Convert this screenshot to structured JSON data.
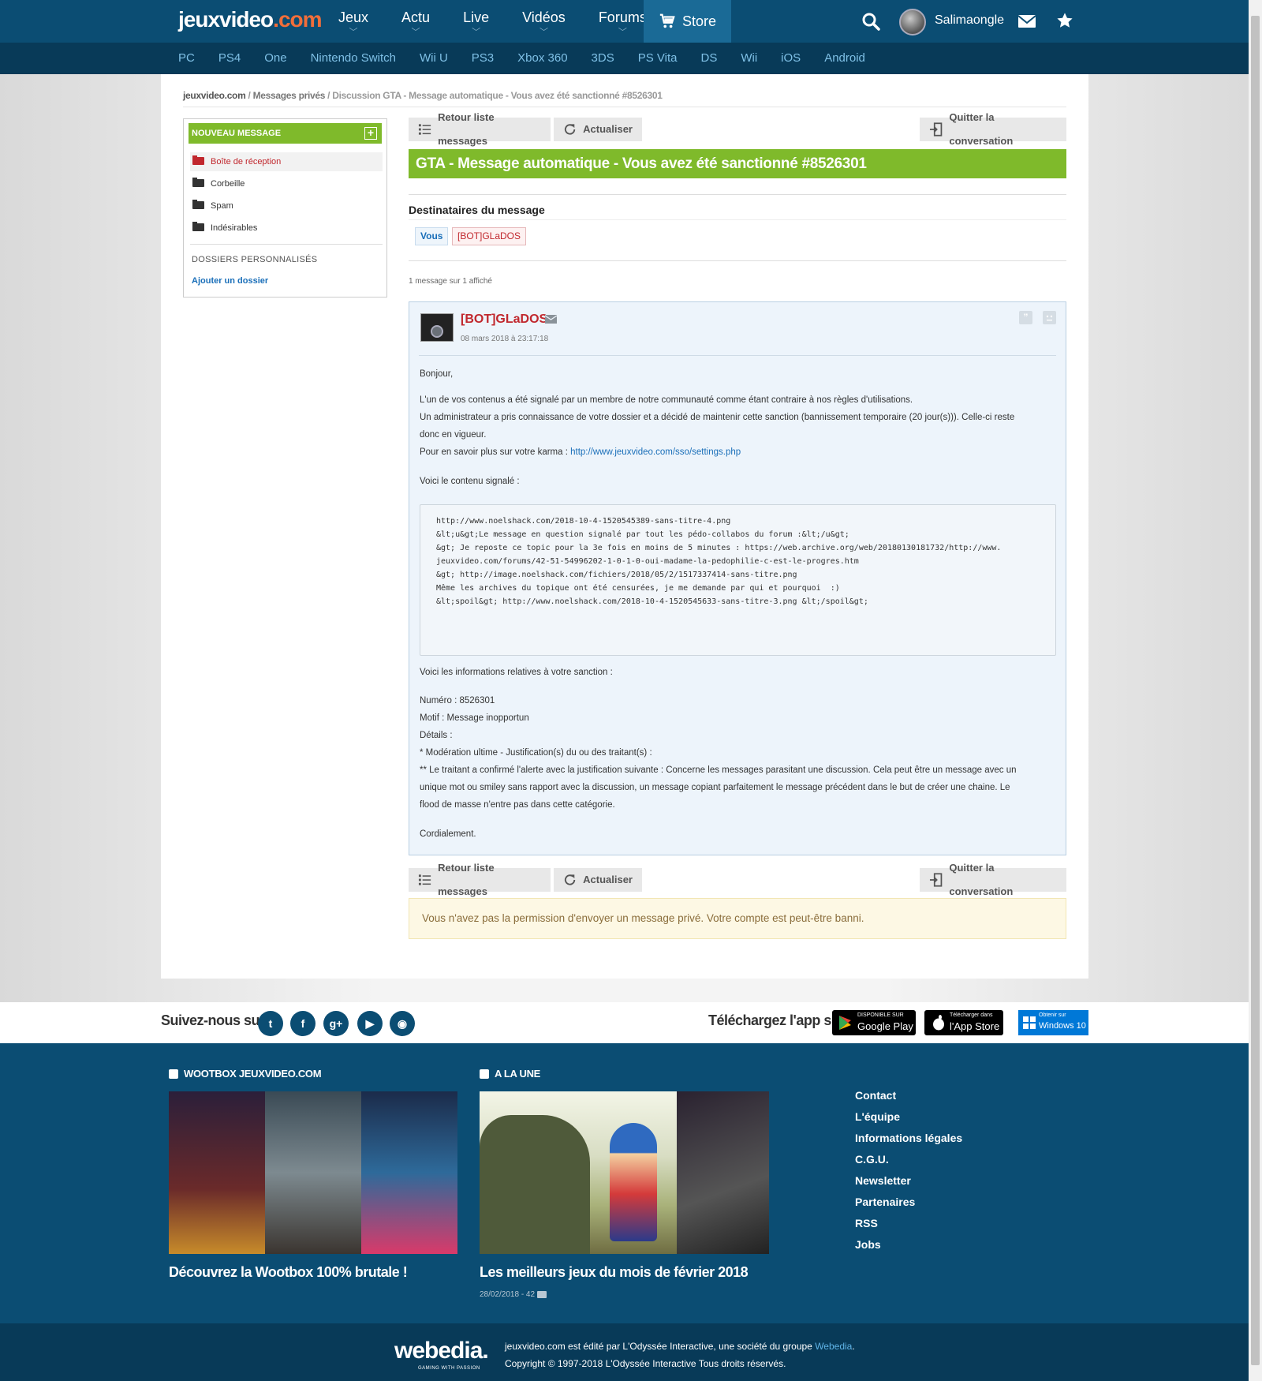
{
  "brand": {
    "logo_part1": "jeuxvideo",
    "logo_part2": ".com"
  },
  "header": {
    "nav": [
      "Jeux",
      "Actu",
      "Live",
      "Vidéos",
      "Forums"
    ],
    "store_label": "Store",
    "username": "Salimaongle"
  },
  "platforms": [
    "PC",
    "PS4",
    "One",
    "Nintendo Switch",
    "Wii U",
    "PS3",
    "Xbox 360",
    "3DS",
    "PS Vita",
    "DS",
    "Wii",
    "iOS",
    "Android"
  ],
  "breadcrumb": {
    "site": "jeuxvideo.com",
    "sep1": " / ",
    "section": "Messages privés",
    "sep2": " / ",
    "current": "Discussion GTA - Message automatique - Vous avez été sanctionné #8526301"
  },
  "sidebar": {
    "new_message": "NOUVEAU MESSAGE",
    "folders": [
      "Boîte de réception",
      "Corbeille",
      "Spam",
      "Indésirables"
    ],
    "personal_header": "DOSSIERS PERSONNALISÉS",
    "add_folder": "Ajouter un dossier"
  },
  "toolbar": {
    "back": "Retour liste messages",
    "refresh": "Actualiser",
    "quit": "Quitter la conversation"
  },
  "conversation": {
    "title": "GTA - Message automatique - Vous avez été sanctionné #8526301",
    "recipients_title": "Destinataires du message",
    "recipients": [
      "Vous",
      "[BOT]GLaDOS"
    ],
    "count": "1 message sur 1 affiché"
  },
  "message": {
    "author": "[BOT]GLaDOS",
    "date": "08 mars 2018 à 23:17:18",
    "greeting": "Bonjour,",
    "p1": "L'un de vos contenus a été signalé par un membre de notre communauté comme étant contraire à nos règles d'utilisations.",
    "p2": "Un administrateur a pris connaissance de votre dossier et a décidé de maintenir cette sanction (bannissement temporaire (20 jour(s))). Celle-ci reste",
    "p3": "donc en vigueur.",
    "karma_label": "Pour en savoir plus sur votre karma : ",
    "karma_link": "http://www.jeuxvideo.com/sso/settings.php",
    "reported_label": "Voici le contenu signalé :",
    "code": [
      "http://www.noelshack.com/2018-10-4-1520545389-sans-titre-4.png",
      "",
      "&lt;u&gt;Le message en question signalé par tout les pédo-collabos du forum :&lt;/u&gt;",
      "&gt; Je reposte ce topic pour la 3e fois en moins de 5 minutes : https://web.archive.org/web/20180130181732/http://www.",
      "jeuxvideo.com/forums/42-51-54996202-1-0-1-0-oui-madame-la-pedophilie-c-est-le-progres.htm",
      "&gt; http://image.noelshack.com/fichiers/2018/05/2/1517337414-sans-titre.png",
      "",
      "Même les archives du topique ont été censurées, je me demande par qui et pourquoi  :)",
      "",
      "&lt;spoil&gt; http://www.noelshack.com/2018-10-4-1520545633-sans-titre-3.png &lt;/spoil&gt;"
    ],
    "sanction_label": "Voici les informations relatives à votre sanction :",
    "numero": "Numéro : 8526301",
    "motif": "Motif : Message inopportun",
    "details": "Détails :",
    "d1": "* Modération ultime - Justification(s) du ou des traitant(s) :",
    "d2": "** Le traitant a confirmé l'alerte avec la justification suivante : Concerne les messages parasitant une discussion. Cela peut être un message avec un",
    "d3": "unique mot ou smiley sans rapport avec la discussion, un message copiant parfaitement le message précédent dans le but de créer une chaine. Le",
    "d4": "flood de masse n'entre pas dans cette catégorie.",
    "closing": "Cordialement."
  },
  "permission_notice": "Vous n'avez pas la permission d'envoyer un message privé. Votre compte est peut-être banni.",
  "social": {
    "follow": "Suivez-nous sur",
    "icons": [
      "twitter-icon",
      "facebook-icon",
      "google-plus-icon",
      "youtube-icon",
      "rss-icon"
    ],
    "download": "Téléchargez l'app sur",
    "google_small": "DISPONIBLE SUR",
    "google_big": "Google Play",
    "apple_small": "Télécharger dans",
    "apple_big": "l'App Store",
    "windows_small": "Obtenir sur",
    "windows_big": "Windows 10"
  },
  "footer": {
    "wootbox_header": "WOOTBOX JEUXVIDEO.COM",
    "wootbox_title": "Découvrez la Wootbox 100% brutale !",
    "alaune_header": "A LA UNE",
    "alaune_title": "Les meilleurs jeux du mois de février 2018",
    "alaune_meta": "28/02/2018 - 42",
    "links": [
      "Contact",
      "L'équipe",
      "Informations légales",
      "C.G.U.",
      "Newsletter",
      "Partenaires",
      "RSS",
      "Jobs"
    ],
    "webedia": "webedia.",
    "webedia_tag": "GAMING WITH PASSION",
    "copy_prefix": "jeuxvideo.com est édité par L'Odyssée Interactive, une société du groupe ",
    "copy_link": "Webedia",
    "copy_suffix": ".",
    "copyright": "Copyright © 1997-2018 L'Odyssée Interactive Tous droits réservés."
  },
  "colors": {
    "brand_blue": "#0b4d73",
    "green": "#7fba2b",
    "red": "#c1272d",
    "link": "#1a6fb9"
  }
}
